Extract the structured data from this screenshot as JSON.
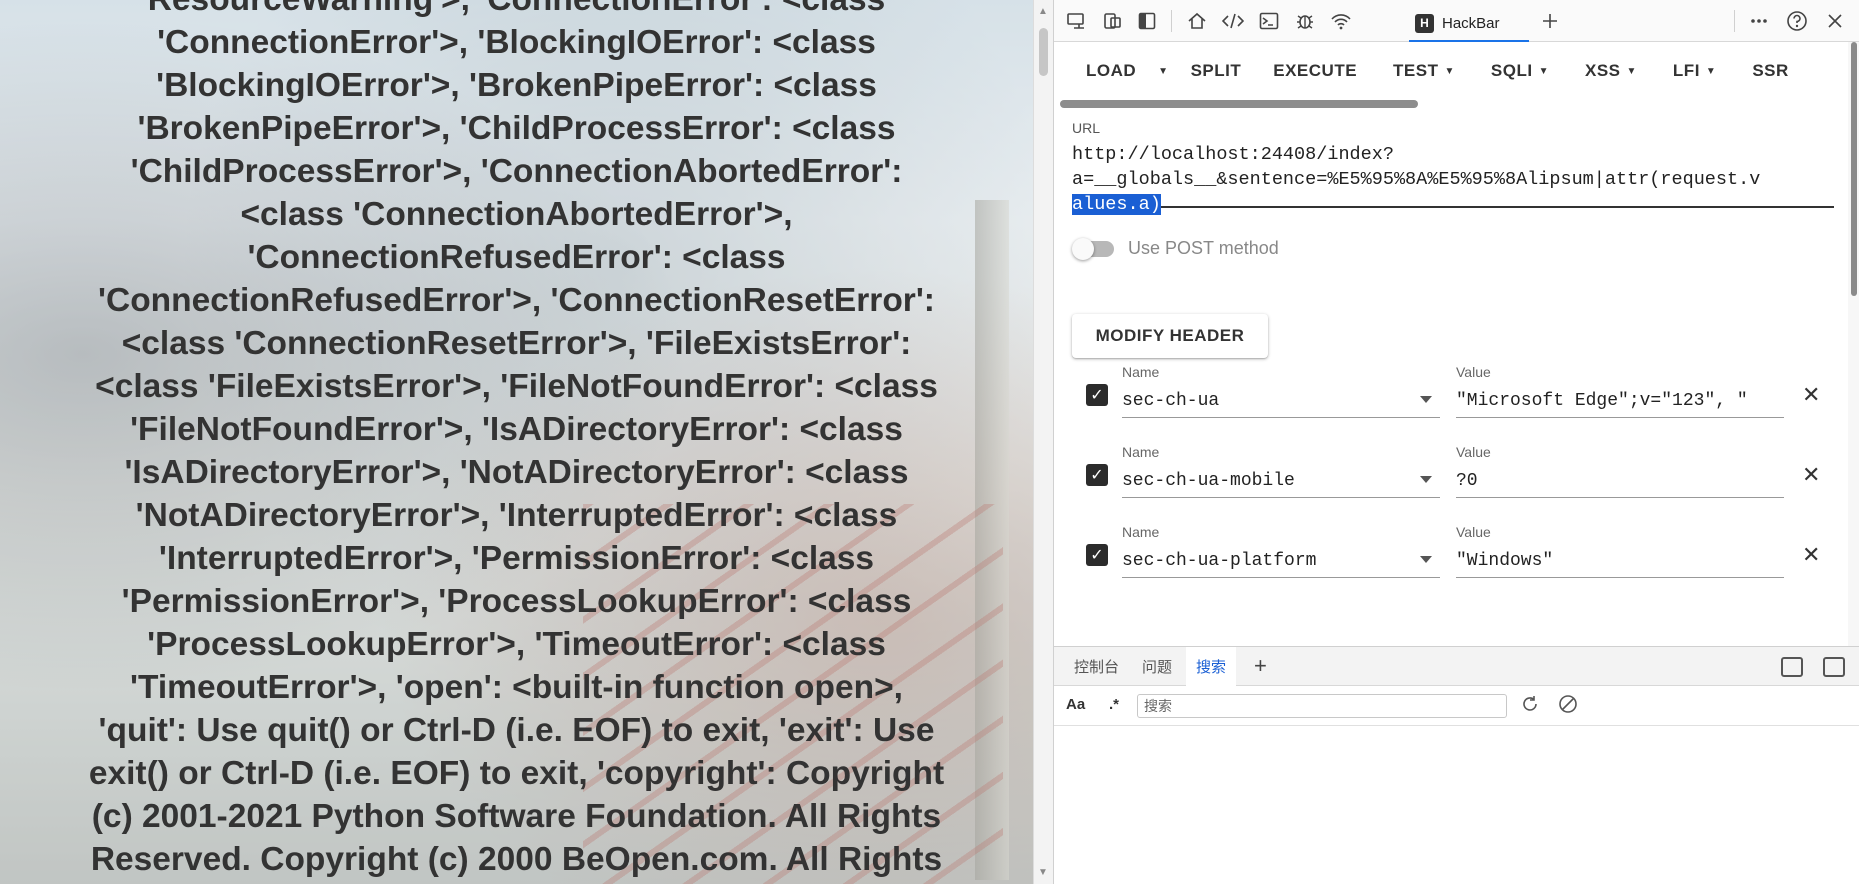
{
  "page": {
    "lines": [
      "ResourceWarning'>, 'ConnectionError': <class",
      "'ConnectionError'>, 'BlockingIOError': <class",
      "'BlockingIOError'>, 'BrokenPipeError': <class",
      "'BrokenPipeError'>, 'ChildProcessError': <class",
      "'ChildProcessError'>, 'ConnectionAbortedError':",
      "<class 'ConnectionAbortedError'>,",
      "'ConnectionRefusedError': <class",
      "'ConnectionRefusedError'>, 'ConnectionResetError':",
      "<class 'ConnectionResetError'>, 'FileExistsError':",
      "<class 'FileExistsError'>, 'FileNotFoundError': <class",
      "'FileNotFoundError'>, 'IsADirectoryError': <class",
      "'IsADirectoryError'>, 'NotADirectoryError': <class",
      "'NotADirectoryError'>, 'InterruptedError': <class",
      "'InterruptedError'>, 'PermissionError': <class",
      "'PermissionError'>, 'ProcessLookupError': <class",
      "'ProcessLookupError'>, 'TimeoutError': <class",
      "'TimeoutError'>, 'open': <built-in function open>,",
      "'quit': Use quit() or Ctrl-D (i.e. EOF) to exit, 'exit': Use",
      "exit() or Ctrl-D (i.e. EOF) to exit, 'copyright': Copyright",
      "(c) 2001-2021 Python Software Foundation. All Rights",
      "Reserved. Copyright (c) 2000 BeOpen.com. All Rights"
    ]
  },
  "devtools": {
    "toolbar": {
      "hackbar_tab": "HackBar",
      "icons": [
        "device-emulation-icon",
        "inspect-icon",
        "sidebar-icon",
        "home-icon",
        "sources-icon",
        "console-icon",
        "debug-icon",
        "network-icon",
        "add-tab-icon",
        "more-icon",
        "help-icon",
        "close-icon"
      ]
    },
    "hackbar": {
      "menu": [
        {
          "label": "LOAD",
          "caret": false
        },
        {
          "label": "SPLIT",
          "caret": false
        },
        {
          "label": "EXECUTE",
          "caret": false
        },
        {
          "label": "TEST",
          "caret": true
        },
        {
          "label": "SQLI",
          "caret": true
        },
        {
          "label": "XSS",
          "caret": true
        },
        {
          "label": "LFI",
          "caret": true
        },
        {
          "label": "SSR",
          "caret": false
        }
      ],
      "url_label": "URL",
      "url_lines": [
        "http://localhost:24408/index?",
        "a=__globals__&sentence=%E5%95%8A%E5%95%8Alipsum|attr(request.v",
        "alues.a)"
      ],
      "post_label": "Use POST method",
      "post_enabled": false,
      "modify_header_label": "MODIFY HEADER",
      "headers": [
        {
          "name_label": "Name",
          "value_label": "Value",
          "name": "sec-ch-ua",
          "value": "\"Microsoft Edge\";v=\"123\", \"",
          "checked": true
        },
        {
          "name_label": "Name",
          "value_label": "Value",
          "name": "sec-ch-ua-mobile",
          "value": "?0",
          "checked": true
        },
        {
          "name_label": "Name",
          "value_label": "Value",
          "name": "sec-ch-ua-platform",
          "value": "\"Windows\"",
          "checked": true
        }
      ]
    },
    "drawer": {
      "tabs": [
        "控制台",
        "问题",
        "搜索"
      ],
      "active_tab": "搜索",
      "search": {
        "case_option": "Aa",
        "regex_option": ".*",
        "placeholder": "搜索"
      }
    },
    "colors": {
      "accent": "#1a5fd4",
      "selection": "#1a5fd4",
      "checkbox": "#2b2b2b"
    }
  }
}
